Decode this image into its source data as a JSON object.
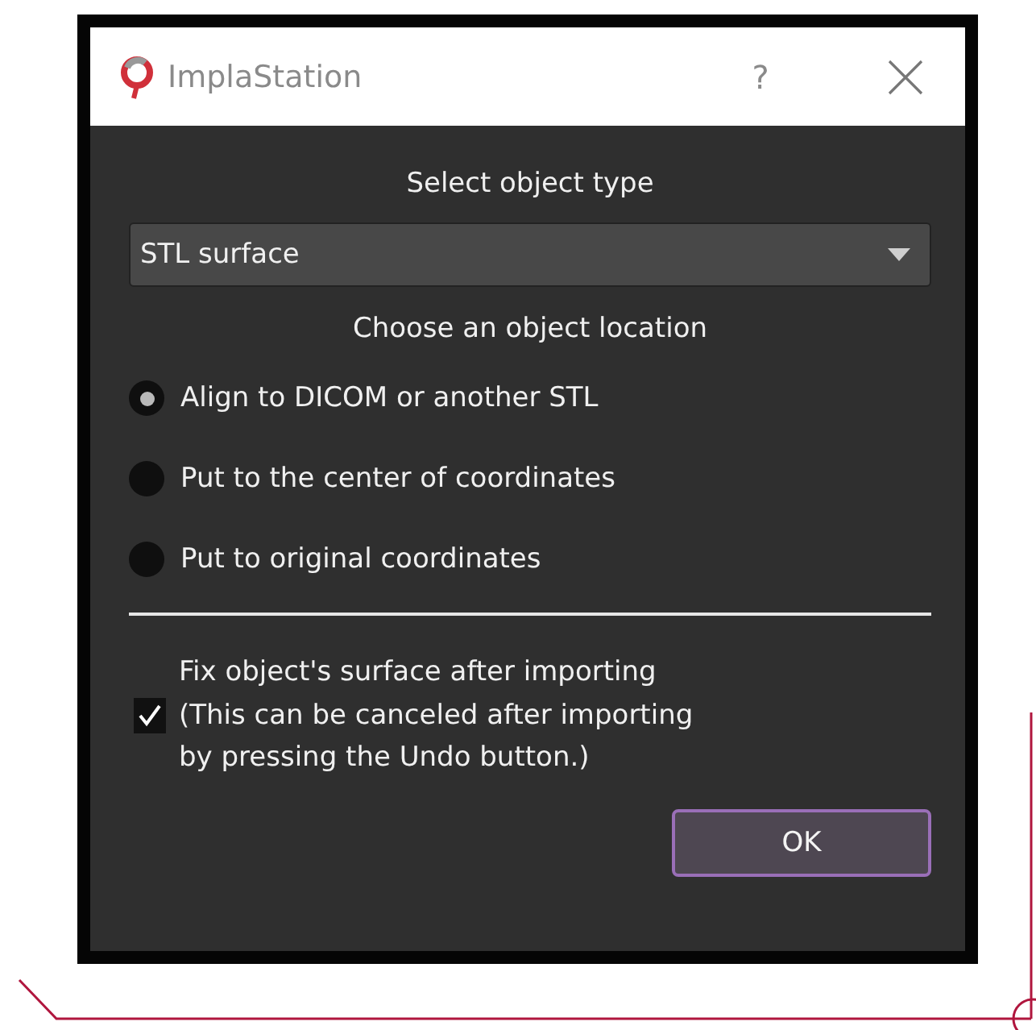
{
  "window": {
    "title": "ImplaStation",
    "help": "?"
  },
  "type_section": {
    "heading": "Select object type",
    "dropdown": {
      "value": "STL surface"
    }
  },
  "location_section": {
    "heading": "Choose an object location",
    "options": [
      {
        "label": "Align to DICOM or another STL",
        "selected": true
      },
      {
        "label": "Put to the center of coordinates",
        "selected": false
      },
      {
        "label": "Put to original coordinates",
        "selected": false
      }
    ]
  },
  "fix_option": {
    "checked": true,
    "lines": [
      "Fix object's surface after importing",
      "(This can be canceled after importing",
      "by pressing the Undo button.)"
    ]
  },
  "buttons": [
    "OK"
  ]
}
